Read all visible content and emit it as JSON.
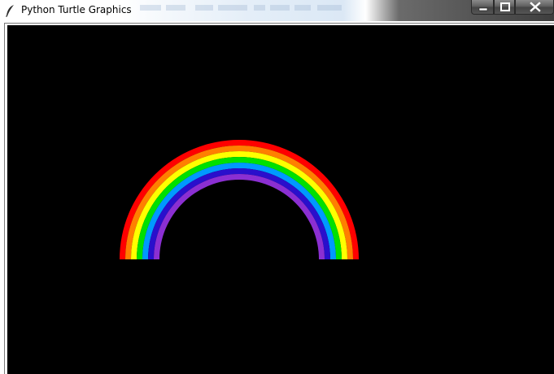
{
  "window": {
    "title": "Python Turtle Graphics",
    "app_icon": "feather-icon",
    "controls": {
      "minimize_icon": "minimize-icon",
      "maximize_icon": "maximize-icon",
      "close_icon": "close-icon"
    }
  },
  "canvas": {
    "background": "#000000",
    "drawing": "rainbow-arc",
    "bands": [
      {
        "color": "#ff0000"
      },
      {
        "color": "#ff7f00"
      },
      {
        "color": "#ffff00"
      },
      {
        "color": "#00e000"
      },
      {
        "color": "#0099ff"
      },
      {
        "color": "#2a0fcc"
      },
      {
        "color": "#8b2fd2"
      }
    ]
  }
}
